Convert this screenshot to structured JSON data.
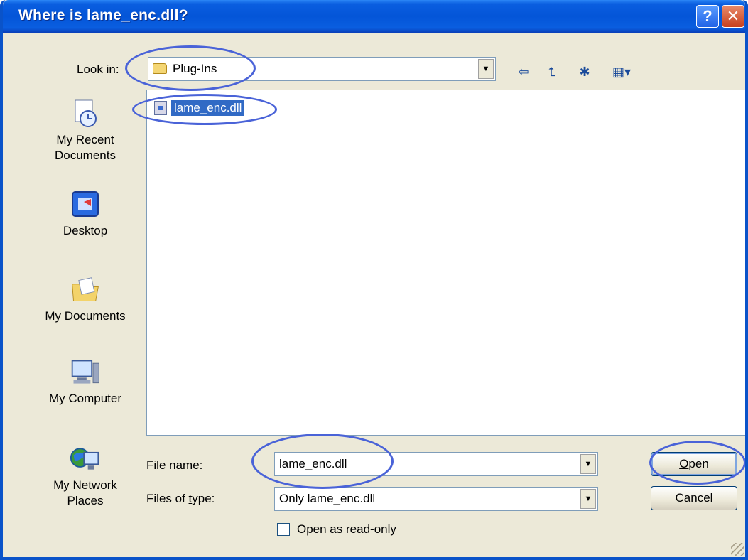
{
  "window": {
    "title": "Where is lame_enc.dll?",
    "help_label": "?",
    "close_label": "✕"
  },
  "look_in": {
    "label": "Look in:",
    "value": "Plug-Ins"
  },
  "toolbar": {
    "back_glyph": "⇦",
    "up_glyph": "⮤",
    "new_folder_glyph": "✱",
    "view_glyph": "▦▾"
  },
  "places": [
    {
      "label_line1": "My Recent",
      "label_line2": "Documents",
      "icon": "clock-icon"
    },
    {
      "label_line1": "Desktop",
      "label_line2": "",
      "icon": "desktop-icon"
    },
    {
      "label_line1": "My Documents",
      "label_line2": "",
      "icon": "folder-documents-icon"
    },
    {
      "label_line1": "My Computer",
      "label_line2": "",
      "icon": "computer-icon"
    },
    {
      "label_line1": "My Network",
      "label_line2": "Places",
      "icon": "network-icon"
    }
  ],
  "files": [
    {
      "name": "lame_enc.dll",
      "icon": "dll-file-icon",
      "selected": true
    }
  ],
  "file_name": {
    "label_pre": "File ",
    "label_accel": "n",
    "label_post": "ame:",
    "value": "lame_enc.dll"
  },
  "file_type": {
    "label_pre": "Files of ",
    "label_accel": "t",
    "label_post": "ype:",
    "value": "Only lame_enc.dll"
  },
  "read_only": {
    "label_pre": "Open as ",
    "label_accel": "r",
    "label_post": "ead-only",
    "checked": false
  },
  "buttons": {
    "open_accel": "O",
    "open_rest": "pen",
    "cancel": "Cancel"
  },
  "colors": {
    "annotation": "#4a63d8",
    "selection": "#316ac5",
    "titlebar": "#0455d8"
  }
}
